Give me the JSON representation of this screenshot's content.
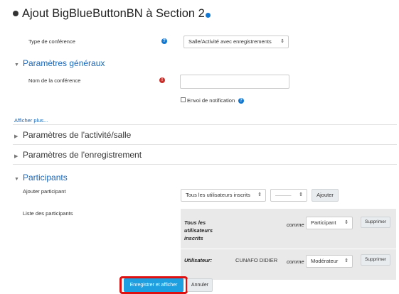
{
  "page": {
    "title": "Ajout BigBlueButtonBN à Section 2"
  },
  "type_conf": {
    "label": "Type de conférence",
    "value": "Salle/Activité avec enregistrements"
  },
  "sections": {
    "general": "Paramètres généraux",
    "activity": "Paramètres de l'activité/salle",
    "recording": "Paramètres de l'enregistrement",
    "participants": "Participants"
  },
  "name_field": {
    "label": "Nom de la conférence",
    "value": ""
  },
  "notification": {
    "label": "Envoi de notification"
  },
  "show_more": "Afficher plus...",
  "add_participant": {
    "label": "Ajouter participant",
    "select1": "Tous les utilisateurs inscrits",
    "select2": "———",
    "button": "Ajouter"
  },
  "participant_list": {
    "label": "Liste des participants",
    "rows": [
      {
        "who": "Tous les utilisateurs inscrits",
        "comme": "comme",
        "role": "Participant",
        "remove": "Supprimer"
      },
      {
        "who": "Utilisateur:",
        "name": "CUNAFO DIDIER",
        "comme": "comme",
        "role": "Modérateur",
        "remove": "Supprimer"
      }
    ]
  },
  "actions": {
    "save_display": "Enregistrer et afficher",
    "cancel": "Annuler"
  },
  "colors": {
    "primary": "#1177d1",
    "link": "#1a67b8",
    "highlight": "#e01010",
    "error": "#c9302c"
  }
}
